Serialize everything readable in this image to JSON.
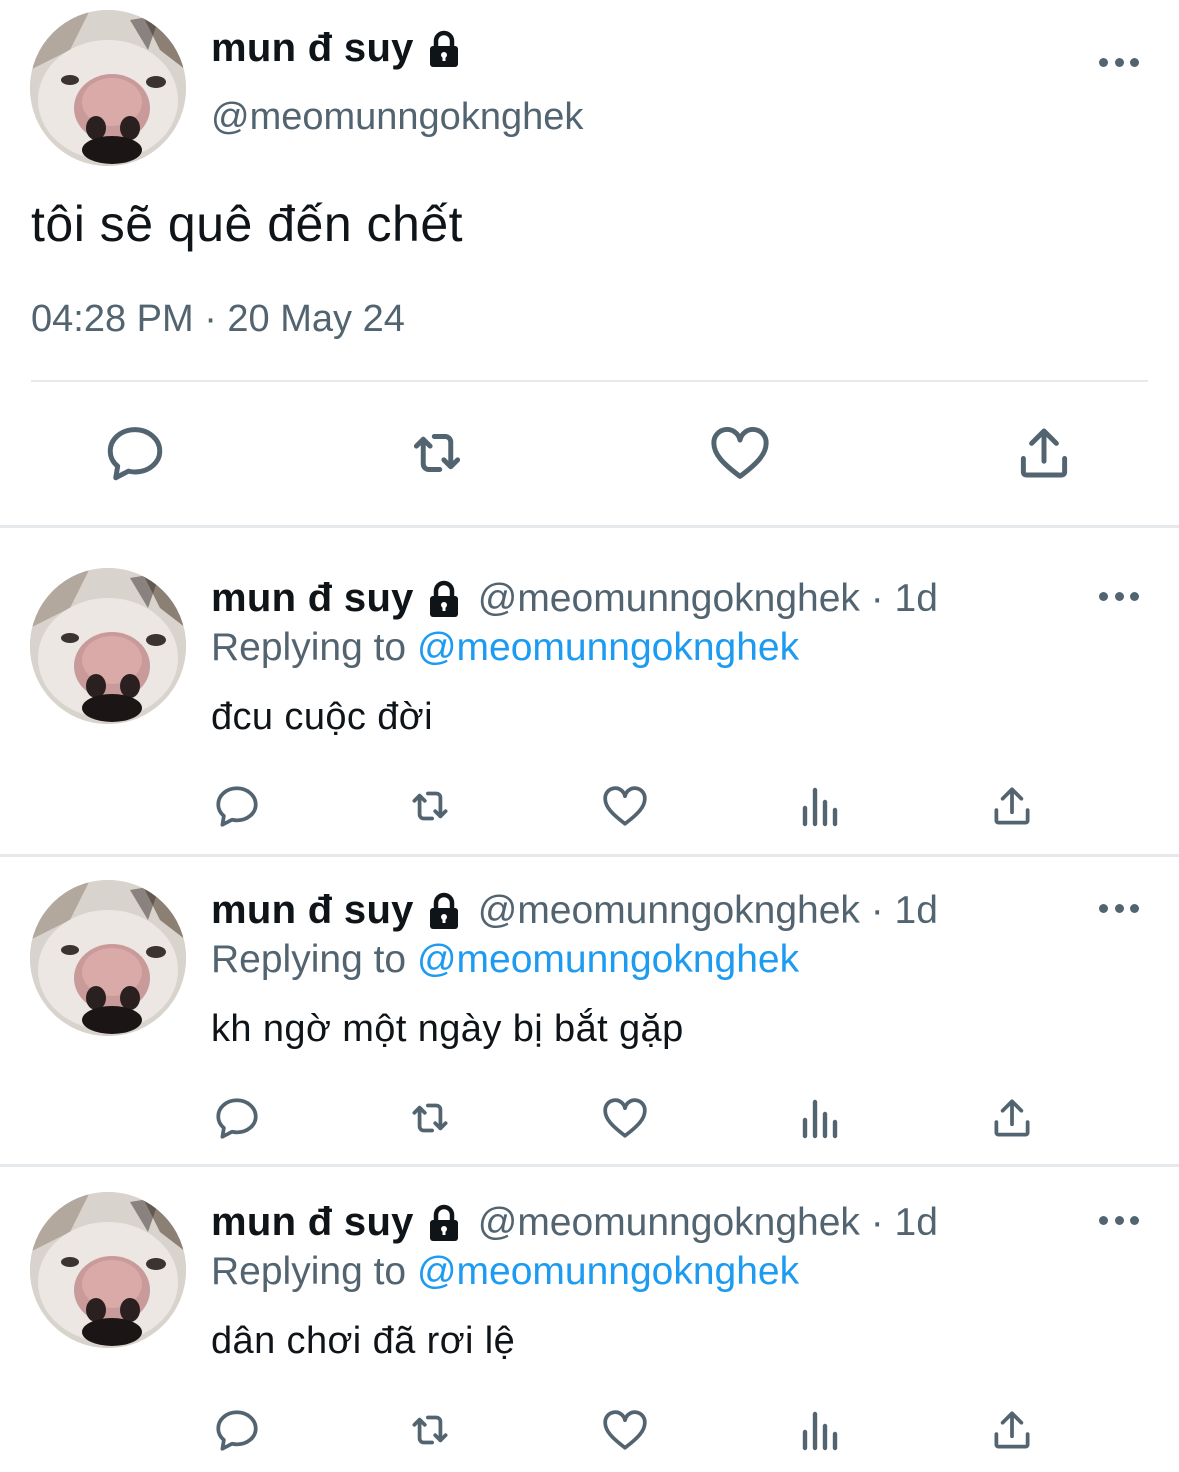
{
  "main_tweet": {
    "name": "mun đ suy",
    "handle": "@meomunngoknghek",
    "text": "tôi sẽ quê đến chết",
    "timestamp": "04:28 PM · 20 May 24",
    "icons": [
      "lock-icon",
      "more-icon",
      "reply-icon",
      "retweet-icon",
      "like-icon",
      "share-icon"
    ]
  },
  "replies": [
    {
      "name": "mun đ suy",
      "handle_time": "@meomunngoknghek · 1d",
      "replying_label": "Replying to ",
      "replying_handle": "@meomunngoknghek",
      "text": "đcu cuộc đời"
    },
    {
      "name": "mun đ suy",
      "handle_time": "@meomunngoknghek · 1d",
      "replying_label": "Replying to ",
      "replying_handle": "@meomunngoknghek",
      "text": "kh ngờ một ngày bị bắt gặp"
    },
    {
      "name": "mun đ suy",
      "handle_time": "@meomunngoknghek · 1d",
      "replying_label": "Replying to ",
      "replying_handle": "@meomunngoknghek",
      "text": "dân chơi đã rơi lệ"
    }
  ],
  "colors": {
    "text": "#0f1419",
    "secondary": "#536471",
    "link": "#1d9bf0",
    "divider": "#e6e9eb"
  }
}
